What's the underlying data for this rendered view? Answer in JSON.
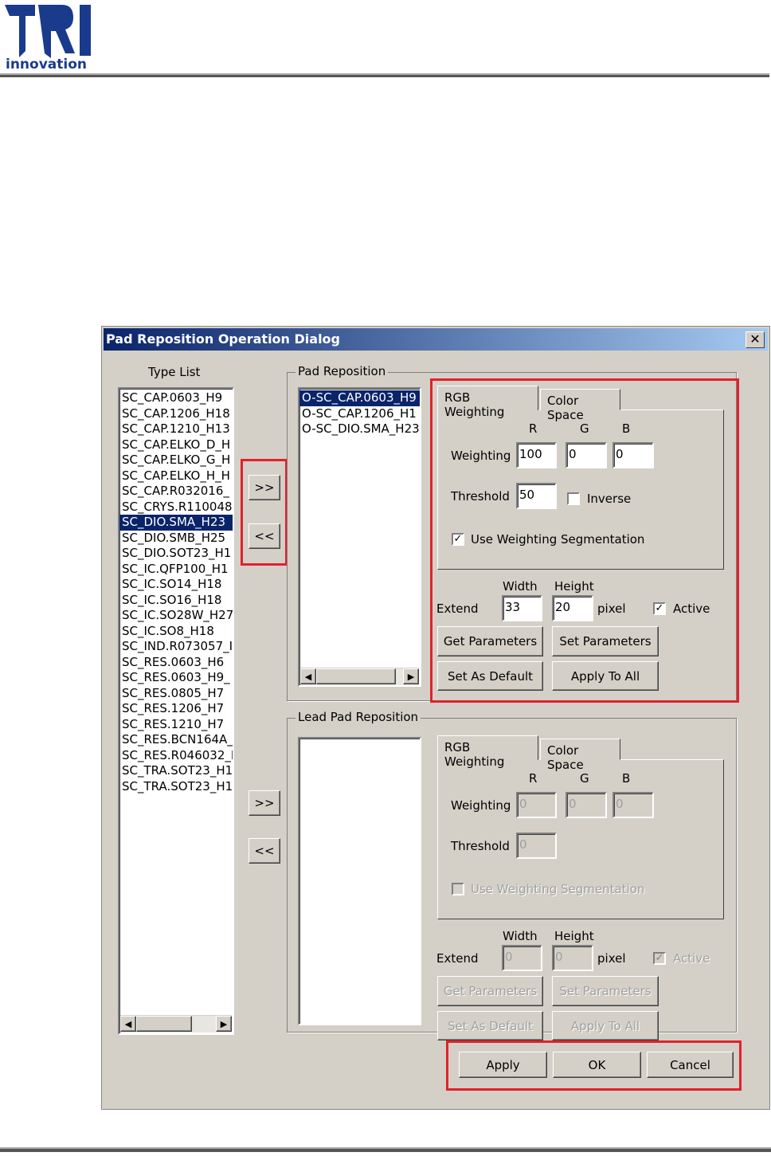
{
  "logo": {
    "text": "TRI",
    "sub": "innovation"
  },
  "dialog": {
    "title": "Pad Reposition Operation Dialog",
    "close": "✕"
  },
  "type_list": {
    "label": "Type List",
    "items": [
      "SC_CAP.0603_H9",
      "SC_CAP.1206_H18",
      "SC_CAP.1210_H13",
      "SC_CAP.ELKO_D_H",
      "SC_CAP.ELKO_G_H",
      "SC_CAP.ELKO_H_H",
      "SC_CAP.R032016_",
      "SC_CRYS.R110048",
      "SC_DIO.SMA_H23",
      "SC_DIO.SMB_H25",
      "SC_DIO.SOT23_H1",
      "SC_IC.QFP100_H1",
      "SC_IC.SO14_H18",
      "SC_IC.SO16_H18",
      "SC_IC.SO28W_H27",
      "SC_IC.SO8_H18",
      "SC_IND.R073057_I",
      "SC_RES.0603_H6",
      "SC_RES.0603_H9_",
      "SC_RES.0805_H7",
      "SC_RES.1206_H7",
      "SC_RES.1210_H7",
      "SC_RES.BCN164A_",
      "SC_RES.R046032_I",
      "SC_TRA.SOT23_H1",
      "SC_TRA.SOT23_H1"
    ],
    "selected": 8
  },
  "move": {
    "add": ">>",
    "remove": "<<"
  },
  "pad": {
    "group": "Pad Reposition",
    "items": [
      "O-SC_CAP.0603_H9",
      "O-SC_CAP.1206_H1",
      "O-SC_DIO.SMA_H23"
    ],
    "selected": 0,
    "tabs": [
      "RGB Weighting",
      "Color Space"
    ],
    "r": "R",
    "g": "G",
    "b": "B",
    "weighting": "Weighting",
    "wr": "100",
    "wg": "0",
    "wb": "0",
    "threshold": "Threshold",
    "th": "50",
    "inverse": "Inverse",
    "inverse_checked": false,
    "use_seg": "Use Weighting Segmentation",
    "use_seg_checked": true,
    "width": "Width",
    "height": "Height",
    "extend": "Extend",
    "ew": "33",
    "eh": "20",
    "pixel": "pixel",
    "active": "Active",
    "active_checked": true,
    "get": "Get Parameters",
    "set": "Set Parameters",
    "default": "Set As Default",
    "apply_all": "Apply To All"
  },
  "lead": {
    "group": "Lead Pad Reposition",
    "items": [],
    "tabs": [
      "RGB Weighting",
      "Color Space"
    ],
    "r": "R",
    "g": "G",
    "b": "B",
    "weighting": "Weighting",
    "wr": "0",
    "wg": "0",
    "wb": "0",
    "threshold": "Threshold",
    "th": "0",
    "inverse": "",
    "use_seg": "Use Weighting Segmentation",
    "use_seg_checked": false,
    "width": "Width",
    "height": "Height",
    "extend": "Extend",
    "ew": "0",
    "eh": "0",
    "pixel": "pixel",
    "active": "Active",
    "active_checked": true,
    "get": "Get Parameters",
    "set": "Set Parameters",
    "default": "Set As Default",
    "apply_all": "Apply To All"
  },
  "footer": {
    "apply": "Apply",
    "ok": "OK",
    "cancel": "Cancel"
  }
}
